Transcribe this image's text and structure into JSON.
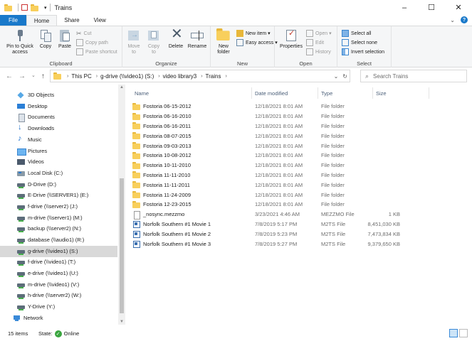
{
  "window": {
    "title": "Trains",
    "minimize": "–",
    "maximize": "☐",
    "close": "✕"
  },
  "menu": {
    "file": "File",
    "home": "Home",
    "share": "Share",
    "view": "View"
  },
  "ribbon": {
    "clipboard": {
      "label": "Clipboard",
      "pin": "Pin to Quick access",
      "copy": "Copy",
      "paste": "Paste",
      "cut": "Cut",
      "copy_path": "Copy path",
      "paste_shortcut": "Paste shortcut"
    },
    "organize": {
      "label": "Organize",
      "move_to": "Move to",
      "copy_to": "Copy to",
      "delete": "Delete",
      "rename": "Rename"
    },
    "new": {
      "label": "New",
      "new_folder": "New folder",
      "new_item": "New item ▾",
      "easy_access": "Easy access ▾"
    },
    "open": {
      "label": "Open",
      "properties": "Properties",
      "open": "Open ▾",
      "edit": "Edit",
      "history": "History"
    },
    "select": {
      "label": "Select",
      "select_all": "Select all",
      "select_none": "Select none",
      "invert": "Invert selection"
    }
  },
  "address": {
    "crumbs": [
      "This PC",
      "g-drive (\\\\video1) (S:)",
      "video library3",
      "Trains"
    ]
  },
  "search": {
    "placeholder": "Search Trains"
  },
  "nav": {
    "items": [
      {
        "label": "3D Objects",
        "icon": "cube"
      },
      {
        "label": "Desktop",
        "icon": "desk"
      },
      {
        "label": "Documents",
        "icon": "docs"
      },
      {
        "label": "Downloads",
        "icon": "down"
      },
      {
        "label": "Music",
        "icon": "music"
      },
      {
        "label": "Pictures",
        "icon": "pics"
      },
      {
        "label": "Videos",
        "icon": "vids"
      },
      {
        "label": "Local Disk (C:)",
        "icon": "local"
      },
      {
        "label": "D-Drive (D:)",
        "icon": "drive"
      },
      {
        "label": "E-Drive (\\\\SERVER1) (E:)",
        "icon": "drive"
      },
      {
        "label": "f-drive (\\\\server2) (J:)",
        "icon": "drive"
      },
      {
        "label": "m-drive (\\\\server1) (M:)",
        "icon": "drive"
      },
      {
        "label": "backup (\\\\server2) (N:)",
        "icon": "drive"
      },
      {
        "label": "database (\\\\audio1) (R:)",
        "icon": "drive"
      },
      {
        "label": "g-drive (\\\\video1) (S:)",
        "icon": "drive"
      },
      {
        "label": "f-drive (\\\\video1) (T:)",
        "icon": "drive"
      },
      {
        "label": "e-drive (\\\\video1) (U:)",
        "icon": "drive"
      },
      {
        "label": "m-drive (\\\\video1) (V:)",
        "icon": "drive"
      },
      {
        "label": "h-drive (\\\\server2) (W:)",
        "icon": "drive"
      },
      {
        "label": "Y-Drive (Y:)",
        "icon": "drive"
      },
      {
        "label": "Network",
        "icon": "net"
      }
    ],
    "selected_label": "g-drive (\\\\video1) (S:)"
  },
  "columns": {
    "name": "Name",
    "date": "Date modified",
    "type": "Type",
    "size": "Size"
  },
  "files": [
    {
      "name": "Fostoria 06-15-2012",
      "date": "12/18/2021 8:01 AM",
      "type": "File folder",
      "size": "",
      "icon": "folder"
    },
    {
      "name": "Fostoria 06-16-2010",
      "date": "12/18/2021 8:01 AM",
      "type": "File folder",
      "size": "",
      "icon": "folder"
    },
    {
      "name": "Fostoria 06-16-2011",
      "date": "12/18/2021 8:01 AM",
      "type": "File folder",
      "size": "",
      "icon": "folder"
    },
    {
      "name": "Fostoria 08-07-2015",
      "date": "12/18/2021 8:01 AM",
      "type": "File folder",
      "size": "",
      "icon": "folder"
    },
    {
      "name": "Fostoria 09-03-2013",
      "date": "12/18/2021 8:01 AM",
      "type": "File folder",
      "size": "",
      "icon": "folder"
    },
    {
      "name": "Fostoria 10-08-2012",
      "date": "12/18/2021 8:01 AM",
      "type": "File folder",
      "size": "",
      "icon": "folder"
    },
    {
      "name": "Fostoria 10-11-2010",
      "date": "12/18/2021 8:01 AM",
      "type": "File folder",
      "size": "",
      "icon": "folder"
    },
    {
      "name": "Fostoria 11-11-2010",
      "date": "12/18/2021 8:01 AM",
      "type": "File folder",
      "size": "",
      "icon": "folder"
    },
    {
      "name": "Fostoria 11-11-2011",
      "date": "12/18/2021 8:01 AM",
      "type": "File folder",
      "size": "",
      "icon": "folder"
    },
    {
      "name": "Fostoria 11-24-2009",
      "date": "12/18/2021 8:01 AM",
      "type": "File folder",
      "size": "",
      "icon": "folder"
    },
    {
      "name": "Fostoria 12-23-2015",
      "date": "12/18/2021 8:01 AM",
      "type": "File folder",
      "size": "",
      "icon": "folder"
    },
    {
      "name": "_nosync.mezzmo",
      "date": "3/23/2021 4:46 AM",
      "type": "MEZZMO File",
      "size": "1 KB",
      "icon": "doc"
    },
    {
      "name": "Norfolk Southern #1 Movie 1",
      "date": "7/8/2019 5:17 PM",
      "type": "M2TS File",
      "size": "8,451,030 KB",
      "icon": "vid"
    },
    {
      "name": "Norfolk Southern #1 Movie 2",
      "date": "7/8/2019 5:23 PM",
      "type": "M2TS File",
      "size": "7,473,834 KB",
      "icon": "vid"
    },
    {
      "name": "Norfolk Southern #1 Movie 3",
      "date": "7/8/2019 5:27 PM",
      "type": "M2TS File",
      "size": "9,379,650 KB",
      "icon": "vid"
    }
  ],
  "status": {
    "count": "15 items",
    "state_label": "State:",
    "state_value": "Online"
  }
}
